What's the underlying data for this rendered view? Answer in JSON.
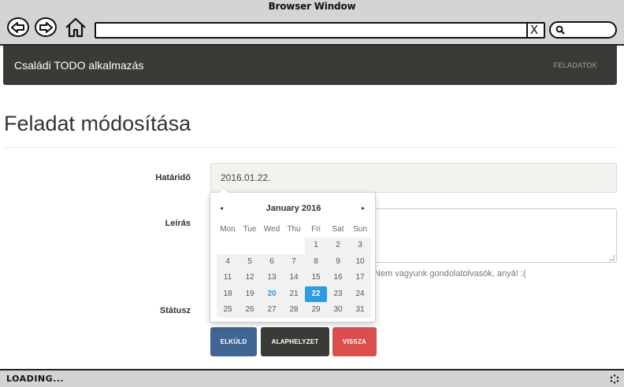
{
  "window": {
    "title": "Browser Window"
  },
  "browser": {
    "url": "",
    "clear_icon": "X",
    "search_placeholder": ""
  },
  "navbar": {
    "brand": "Családi TODO alkalmazás",
    "link": "FELADATOK"
  },
  "page": {
    "title": "Feladat módosítása"
  },
  "form": {
    "deadline_label": "Határidő",
    "deadline_value": "2016.01.22.",
    "description_label": "Leírás",
    "description_value": "",
    "help_text": "Nem vagyunk gondolatolvasók, anyá! :(",
    "status_label": "Státusz"
  },
  "buttons": {
    "submit": "ELKÜLD",
    "reset": "ALAPHELYZET",
    "back": "VISSZA"
  },
  "datepicker": {
    "prev": "◂",
    "next": "▸",
    "month": "January",
    "year": "2016",
    "weekdays": [
      "Mon",
      "Tue",
      "Wed",
      "Thu",
      "Fri",
      "Sat",
      "Sun"
    ],
    "weeks": [
      [
        "",
        "",
        "",
        "",
        "1",
        "2",
        "3"
      ],
      [
        "4",
        "5",
        "6",
        "7",
        "8",
        "9",
        "10"
      ],
      [
        "11",
        "12",
        "13",
        "14",
        "15",
        "16",
        "17"
      ],
      [
        "18",
        "19",
        "20",
        "21",
        "22",
        "23",
        "24"
      ],
      [
        "25",
        "26",
        "27",
        "28",
        "29",
        "30",
        "31"
      ]
    ],
    "today": "20",
    "selected": "22"
  },
  "statusbar": {
    "text": "LOADING..."
  },
  "colors": {
    "navbar_bg": "#3a3a36",
    "primary": "#3f6593",
    "default": "#3a3a36",
    "danger": "#d94f4c",
    "selected_day": "#2f9ce0"
  },
  "icons": {
    "back": "back-arrow-icon",
    "forward": "forward-arrow-icon",
    "home": "home-icon",
    "search": "search-icon",
    "spinner": "loading-spinner-icon"
  }
}
